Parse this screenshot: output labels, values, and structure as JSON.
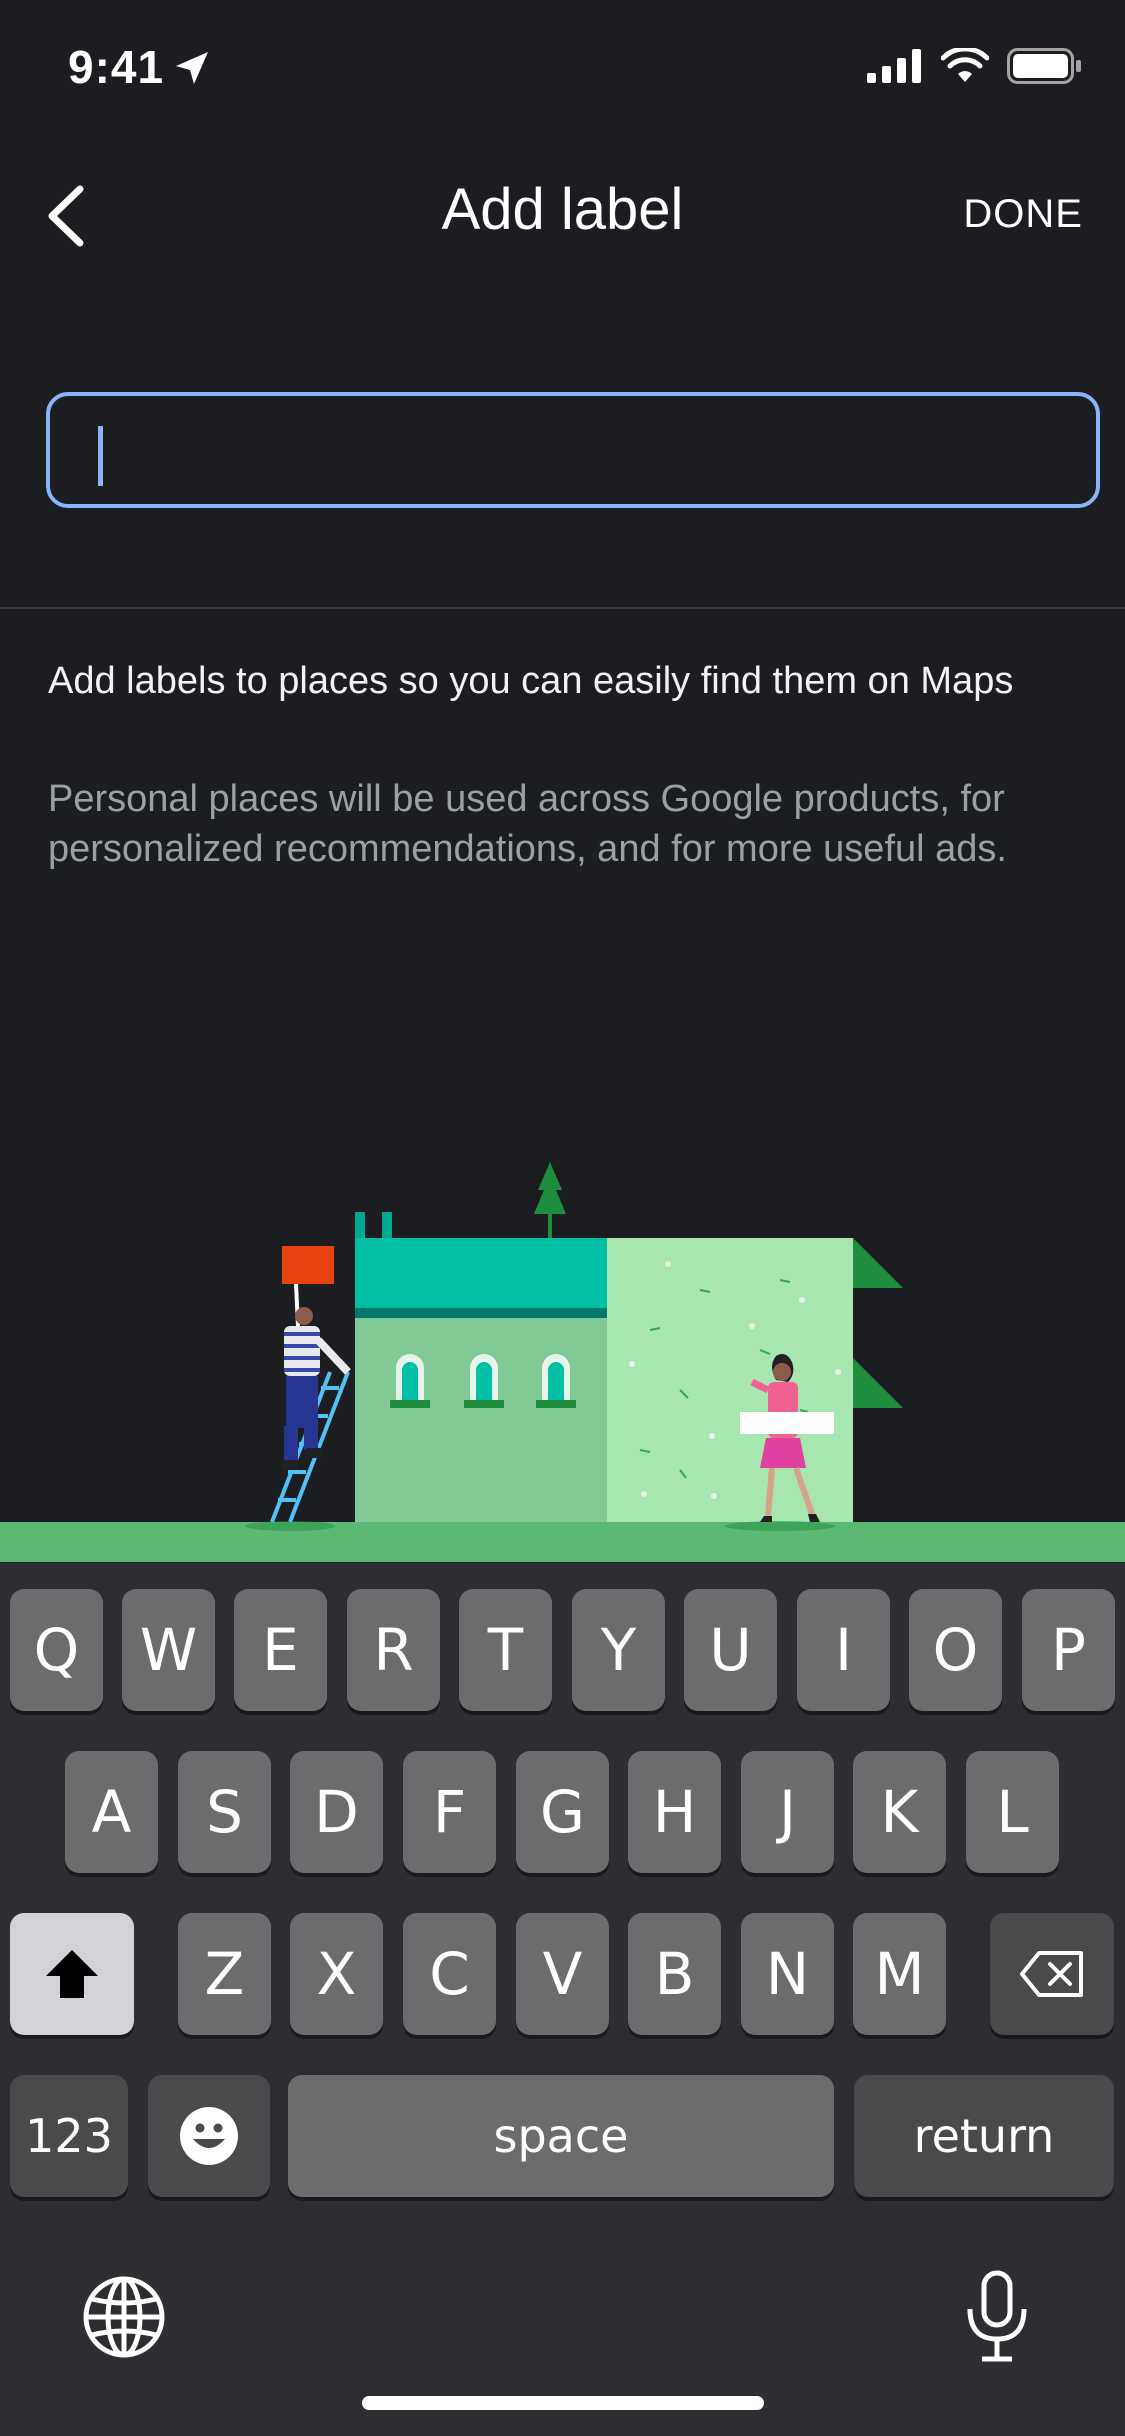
{
  "status": {
    "time": "9:41",
    "icons": [
      "location-arrow-icon",
      "signal-icon",
      "wifi-icon",
      "battery-icon"
    ]
  },
  "header": {
    "title": "Add label",
    "done_label": "DONE",
    "back_icon": "chevron-left-icon"
  },
  "input": {
    "value": "",
    "placeholder": "",
    "accent_color": "#8ab4f8"
  },
  "info": {
    "heading": "Add labels to places so you can easily find them on Maps",
    "body": "Personal places will be used across Google products, for personalized recommendations, and for more useful ads."
  },
  "keyboard": {
    "row1": [
      "Q",
      "W",
      "E",
      "R",
      "T",
      "Y",
      "U",
      "I",
      "O",
      "P"
    ],
    "row2": [
      "A",
      "S",
      "D",
      "F",
      "G",
      "H",
      "J",
      "K",
      "L"
    ],
    "row3": [
      "Z",
      "X",
      "C",
      "V",
      "B",
      "N",
      "M"
    ],
    "numbers_label": "123",
    "space_label": "space",
    "return_label": "return",
    "icons": [
      "shift-icon",
      "delete-icon",
      "emoji-icon",
      "globe-icon",
      "microphone-icon"
    ]
  },
  "colors": {
    "background": "#1c1d21",
    "keyboard_bg": "#2d2e31",
    "key": "#6c6c6f",
    "key_dark": "#4a4a4d",
    "ground": "#5bb974"
  }
}
